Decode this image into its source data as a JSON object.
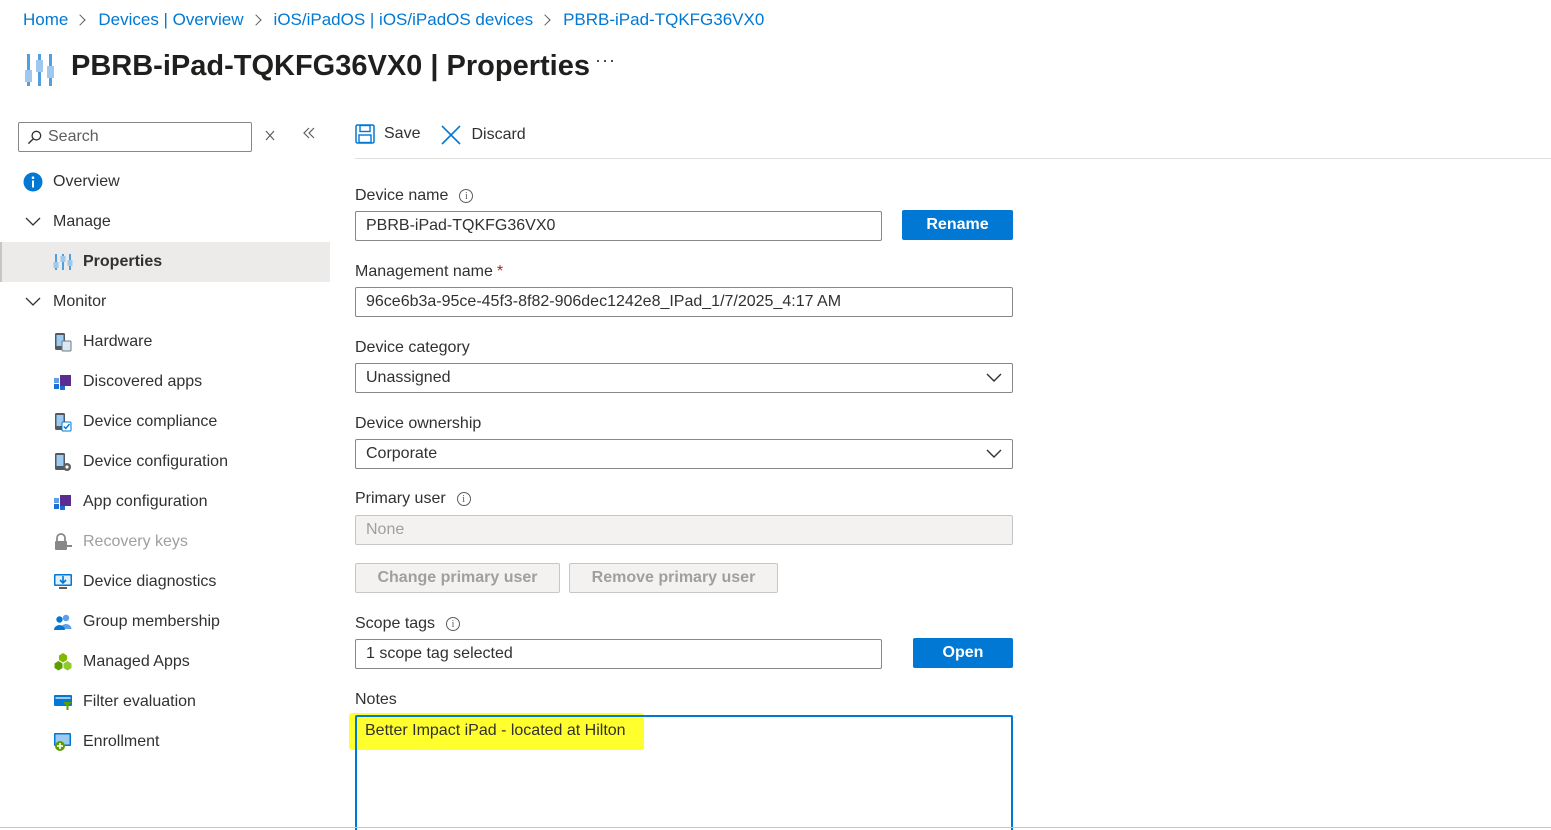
{
  "breadcrumb": [
    "Home",
    "Devices | Overview",
    "iOS/iPadOS | iOS/iPadOS devices",
    "PBRB-iPad-TQKFG36VX0"
  ],
  "title": {
    "device": "PBRB-iPad-TQKFG36VX0",
    "separator": " | ",
    "section": "Properties"
  },
  "more_label": "···",
  "sidebar": {
    "search_placeholder": "Search",
    "items": [
      {
        "label": "Overview",
        "icon": "info-icon"
      },
      {
        "label": "Manage",
        "icon": "chevron-down-icon"
      },
      {
        "label": "Properties",
        "icon": "properties-icon",
        "selected": true
      },
      {
        "label": "Monitor",
        "icon": "chevron-down-icon"
      },
      {
        "label": "Hardware",
        "icon": "hardware-icon"
      },
      {
        "label": "Discovered apps",
        "icon": "apps-icon"
      },
      {
        "label": "Device compliance",
        "icon": "compliance-icon"
      },
      {
        "label": "Device configuration",
        "icon": "configuration-icon"
      },
      {
        "label": "App configuration",
        "icon": "app-config-icon"
      },
      {
        "label": "Recovery keys",
        "icon": "lock-icon",
        "disabled": true
      },
      {
        "label": "Device diagnostics",
        "icon": "diagnostics-icon"
      },
      {
        "label": "Group membership",
        "icon": "group-icon"
      },
      {
        "label": "Managed Apps",
        "icon": "managed-apps-icon"
      },
      {
        "label": "Filter evaluation",
        "icon": "filter-icon"
      },
      {
        "label": "Enrollment",
        "icon": "enrollment-icon"
      }
    ]
  },
  "toolbar": {
    "save_label": "Save",
    "discard_label": "Discard"
  },
  "form": {
    "device_name": {
      "label": "Device name",
      "value": "PBRB-iPad-TQKFG36VX0",
      "button": "Rename"
    },
    "management_name": {
      "label": "Management name",
      "required_mark": "*",
      "value": "96ce6b3a-95ce-45f3-8f82-906dec1242e8_IPad_1/7/2025_4:17 AM"
    },
    "device_category": {
      "label": "Device category",
      "value": "Unassigned"
    },
    "device_ownership": {
      "label": "Device ownership",
      "value": "Corporate"
    },
    "primary_user": {
      "label": "Primary user",
      "value": "None",
      "change_button": "Change primary user",
      "remove_button": "Remove primary user"
    },
    "scope_tags": {
      "label": "Scope tags",
      "value": "1 scope tag selected",
      "button": "Open"
    },
    "notes": {
      "label": "Notes",
      "value": "Better Impact iPad - located at Hilton"
    }
  },
  "colors": {
    "accent": "#0078d4",
    "highlight": "#ffff2e",
    "selected_bg": "#edebe9"
  }
}
